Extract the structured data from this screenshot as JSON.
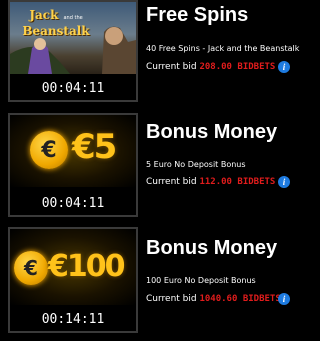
{
  "offers": [
    {
      "title": "Free Spins",
      "description": "40 Free Spins - Jack and the Beanstalk",
      "bid_label": "Current bid",
      "bid_value": "208.00 BIDBETS",
      "timer": "00:04:11",
      "thumb_text_line1": "Jack",
      "thumb_text_line2": "Beanstalk",
      "thumb_text_small": "and the",
      "icon": "info-icon"
    },
    {
      "title": "Bonus Money",
      "description": "5 Euro No Deposit Bonus",
      "bid_label": "Current bid",
      "bid_value": "112.00 BIDBETS",
      "timer": "00:04:11",
      "amount": "€5",
      "coin_symbol": "€",
      "icon": "info-icon"
    },
    {
      "title": "Bonus Money",
      "description": "100 Euro No Deposit Bonus",
      "bid_label": "Current bid",
      "bid_value": "1040.60 BIDBETS",
      "timer": "00:14:11",
      "amount": "€100",
      "coin_symbol": "€",
      "icon": "info-icon"
    }
  ],
  "colors": {
    "bid_value": "#e01c1c",
    "gold": "#ffc21a",
    "info": "#1e7be0"
  }
}
